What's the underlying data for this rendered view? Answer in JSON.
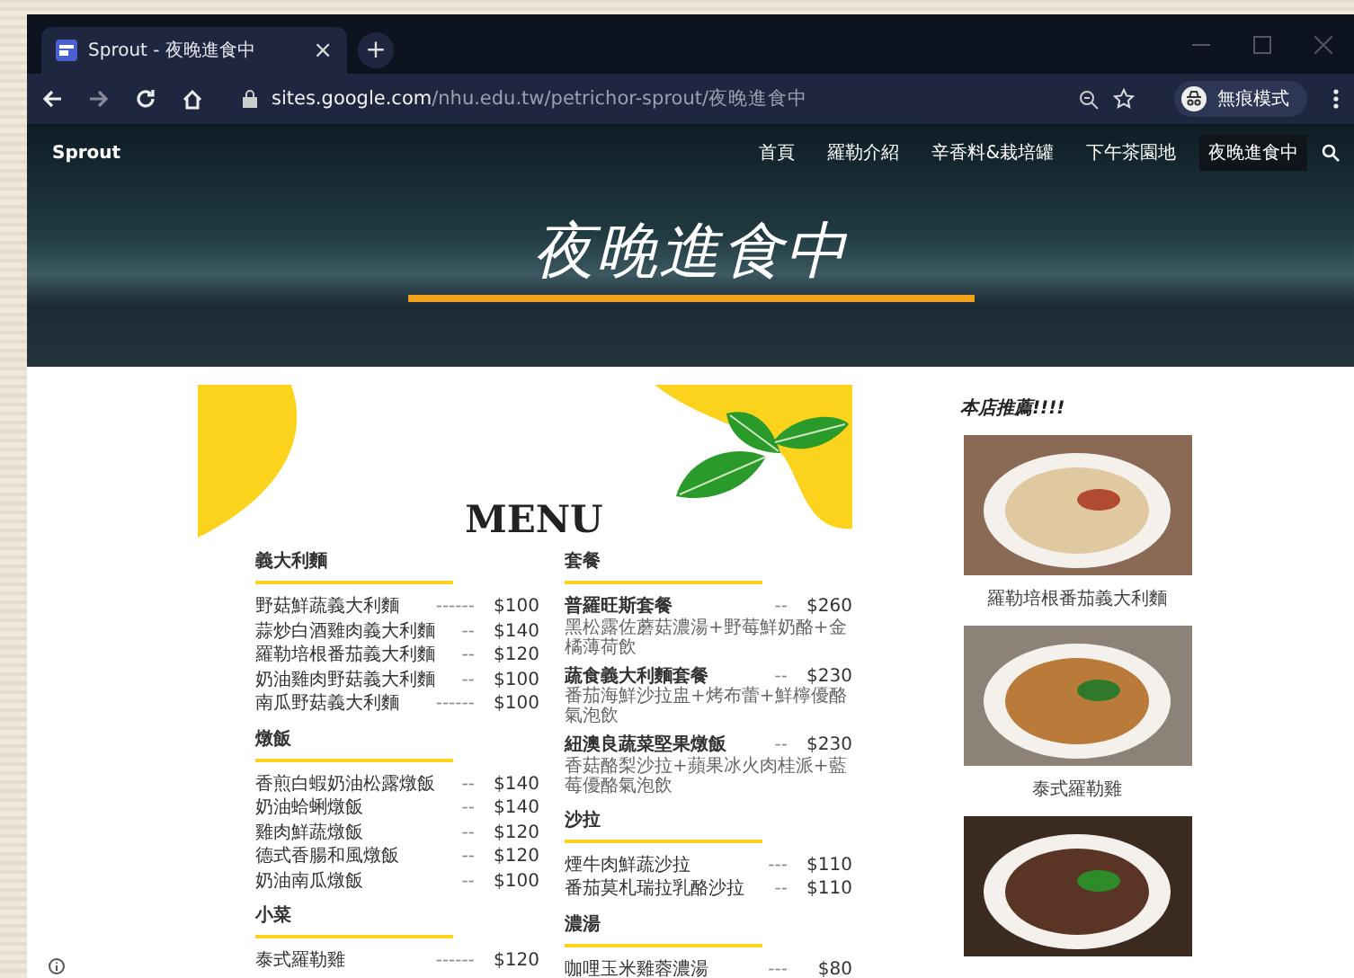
{
  "browser": {
    "tab_title": "Sprout - 夜晚進食中",
    "tab_close": "×",
    "new_tab": "+",
    "url_domain": "sites.google.com",
    "url_path": "/nhu.edu.tw/petrichor-sprout/夜晚進食中",
    "profile": "無痕模式"
  },
  "site": {
    "name": "Sprout",
    "nav": [
      {
        "label": "首頁",
        "selected": false
      },
      {
        "label": "羅勒介紹",
        "selected": false
      },
      {
        "label": "辛香料&栽培罐",
        "selected": false
      },
      {
        "label": "下午茶園地",
        "selected": false
      },
      {
        "label": "夜晚進食中",
        "selected": true
      }
    ],
    "hero_title": "夜晚進食中"
  },
  "menu": {
    "title": "MENU",
    "columns": [
      [
        {
          "heading": "義大利麵",
          "items": [
            {
              "name": "野菇鮮蔬義大利麵",
              "leader": "------",
              "price": "$100"
            },
            {
              "name": "蒜炒白酒雞肉義大利麵",
              "leader": "--",
              "price": "$140"
            },
            {
              "name": "羅勒培根番茄義大利麵",
              "leader": "--",
              "price": "$120"
            },
            {
              "name": "奶油雞肉野菇義大利麵",
              "leader": "--",
              "price": "$100"
            },
            {
              "name": "南瓜野菇義大利麵",
              "leader": "------",
              "price": "$100"
            }
          ]
        },
        {
          "heading": "燉飯",
          "items": [
            {
              "name": "香煎白蝦奶油松露燉飯",
              "leader": "--",
              "price": "$140"
            },
            {
              "name": "奶油蛤蜊燉飯",
              "leader": "--",
              "price": "$140"
            },
            {
              "name": "雞肉鮮蔬燉飯",
              "leader": "--",
              "price": "$120"
            },
            {
              "name": "德式香腸和風燉飯",
              "leader": "--",
              "price": "$120"
            },
            {
              "name": "奶油南瓜燉飯",
              "leader": "--",
              "price": "$100"
            }
          ]
        },
        {
          "heading": "小菜",
          "items": [
            {
              "name": "泰式羅勒雞",
              "leader": "------",
              "price": "$120"
            }
          ]
        }
      ],
      [
        {
          "heading": "套餐",
          "items": [
            {
              "name": "普羅旺斯套餐",
              "leader": "--",
              "price": "$260",
              "description": "黑松露佐蘑菇濃湯+野莓鮮奶酪+金橘薄荷飲"
            },
            {
              "name": "蔬食義大利麵套餐",
              "leader": "--",
              "price": "$230",
              "description": "番茄海鮮沙拉盅+烤布蕾+鮮檸優酪氣泡飲"
            },
            {
              "name": "紐澳良蔬菜堅果燉飯",
              "leader": "--",
              "price": "$230",
              "description": "香菇酪梨沙拉+蘋果冰火肉桂派+藍莓優酪氣泡飲"
            }
          ]
        },
        {
          "heading": "沙拉",
          "items": [
            {
              "name": "煙牛肉鮮蔬沙拉",
              "leader": "---",
              "price": "$110"
            },
            {
              "name": "番茄莫札瑞拉乳酪沙拉",
              "leader": "--",
              "price": "$110"
            }
          ]
        },
        {
          "heading": "濃湯",
          "items": [
            {
              "name": "咖哩玉米雞蓉濃湯",
              "leader": "---",
              "price": "$80"
            }
          ]
        }
      ]
    ]
  },
  "recommend": {
    "title": "本店推薦!!!!",
    "dishes": [
      {
        "kind": "pasta",
        "caption": "羅勒培根番茄義大利麵"
      },
      {
        "kind": "chicken",
        "caption": "泰式羅勒雞"
      },
      {
        "kind": "beef"
      }
    ]
  }
}
